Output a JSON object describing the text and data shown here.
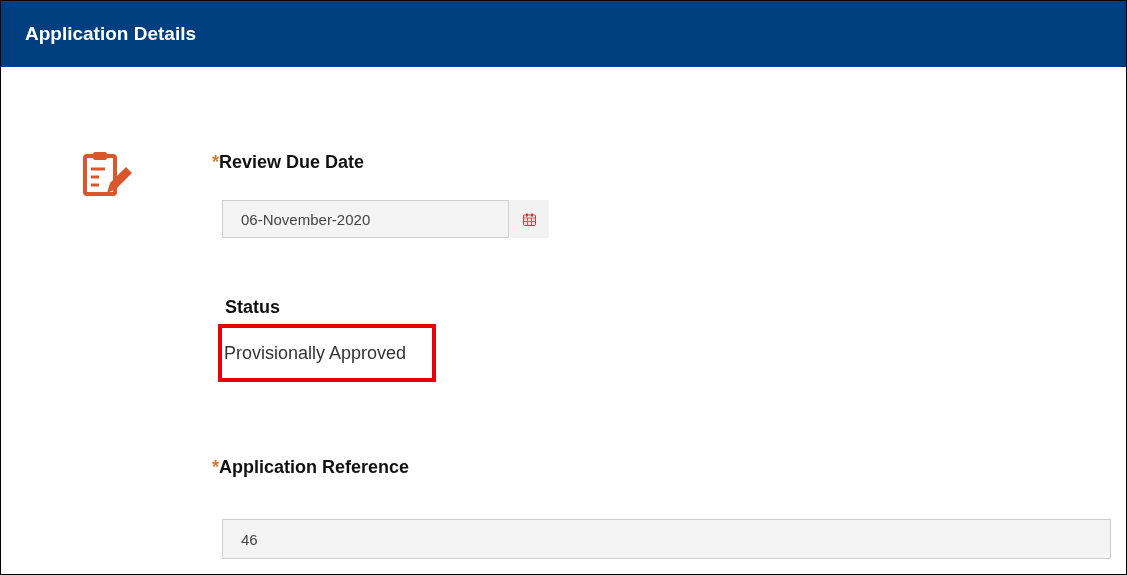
{
  "header": {
    "title": "Application Details"
  },
  "review_due_date": {
    "required_mark": "*",
    "label": "Review Due Date",
    "value": "06-November-2020"
  },
  "status": {
    "label": "Status",
    "value": "Provisionally Approved",
    "highlighted": true
  },
  "application_reference": {
    "required_mark": "*",
    "label": "Application Reference",
    "value": "46"
  }
}
